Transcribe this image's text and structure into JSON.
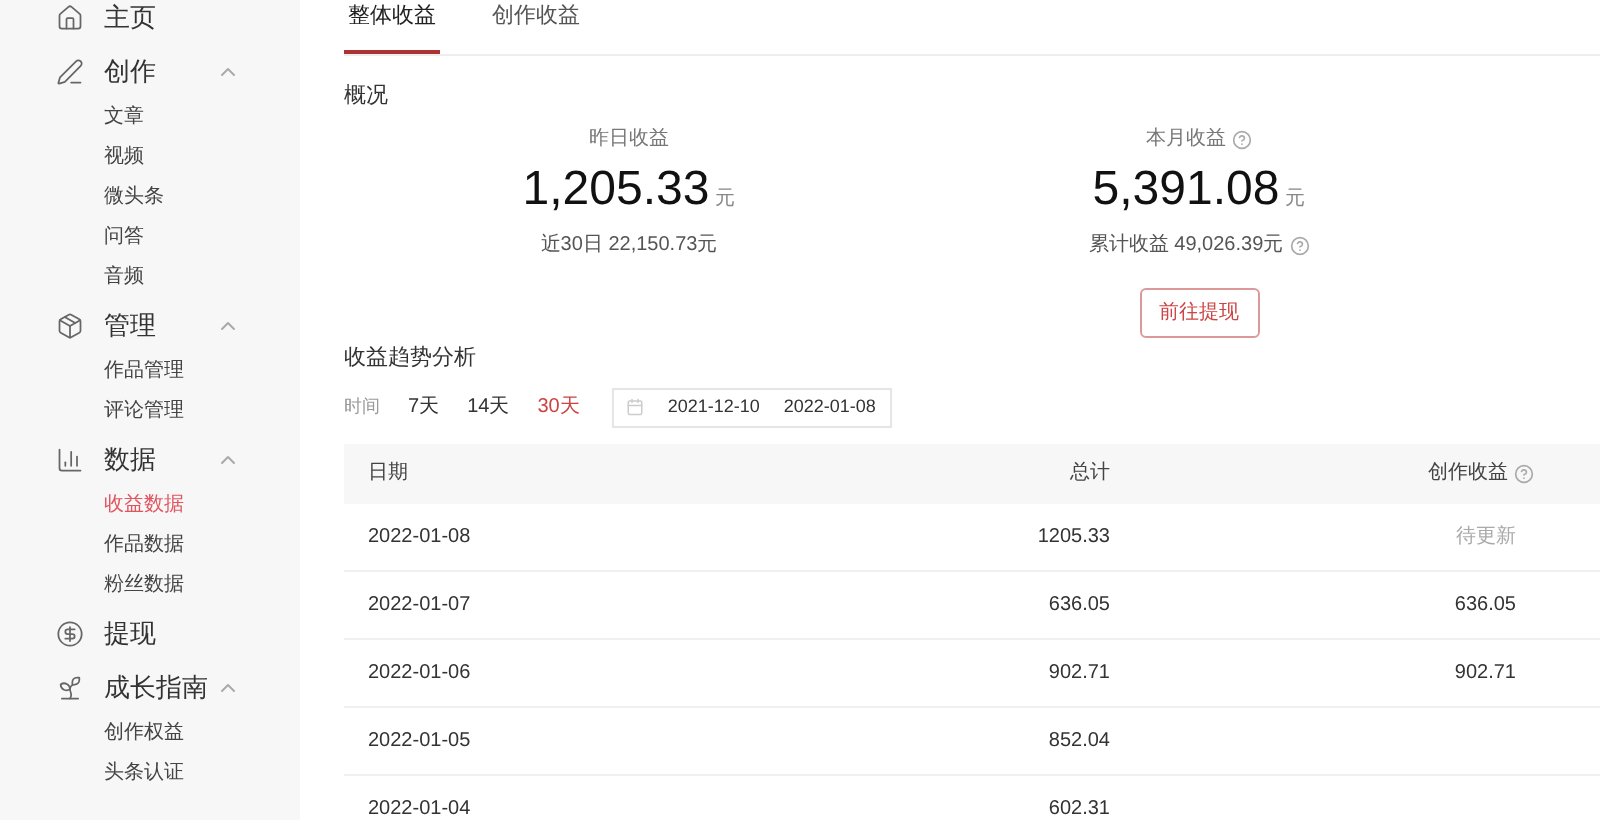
{
  "sidebar": {
    "sections": [
      {
        "title": "主页"
      },
      {
        "title": "创作",
        "expanded": true,
        "items": [
          {
            "label": "文章",
            "selected": false
          },
          {
            "label": "视频",
            "selected": false
          },
          {
            "label": "微头条",
            "selected": false
          },
          {
            "label": "问答",
            "selected": false
          },
          {
            "label": "音频",
            "selected": false
          }
        ]
      },
      {
        "title": "管理",
        "expanded": true,
        "items": [
          {
            "label": "作品管理",
            "selected": false
          },
          {
            "label": "评论管理",
            "selected": false
          }
        ]
      },
      {
        "title": "数据",
        "expanded": true,
        "items": [
          {
            "label": "收益数据",
            "selected": true
          },
          {
            "label": "作品数据",
            "selected": false
          },
          {
            "label": "粉丝数据",
            "selected": false
          }
        ]
      },
      {
        "title": "提现"
      },
      {
        "title": "成长指南",
        "expanded": true,
        "items": [
          {
            "label": "创作权益",
            "selected": false
          },
          {
            "label": "头条认证",
            "selected": false
          }
        ]
      }
    ]
  },
  "tabs": [
    {
      "label": "整体收益",
      "selected": true
    },
    {
      "label": "创作收益",
      "selected": false
    }
  ],
  "overview": {
    "title": "概况",
    "stats": [
      {
        "label": "昨日收益",
        "value": "1,205.33",
        "unit": "元",
        "sub": "近30日 22,150.73元",
        "help": false,
        "sub_help": false
      },
      {
        "label": "本月收益",
        "value": "5,391.08",
        "unit": "元",
        "sub": "累计收益 49,026.39元",
        "help": true,
        "sub_help": true,
        "button": "前往提现"
      }
    ]
  },
  "trend": {
    "title": "收益趋势分析",
    "range_label": "时间",
    "ranges": [
      {
        "label": "7天",
        "selected": false
      },
      {
        "label": "14天",
        "selected": false
      },
      {
        "label": "30天",
        "selected": true
      }
    ],
    "start": "2021-12-10",
    "end": "2022-01-08"
  },
  "table": {
    "columns": [
      "日期",
      "总计",
      "创作收益"
    ],
    "rows": [
      {
        "date": "2022-01-08",
        "total": "1205.33",
        "creation": "待更新",
        "pending": true
      },
      {
        "date": "2022-01-07",
        "total": "636.05",
        "creation": "636.05",
        "pending": false
      },
      {
        "date": "2022-01-06",
        "total": "902.71",
        "creation": "902.71",
        "pending": false
      },
      {
        "date": "2022-01-05",
        "total": "852.04"
      },
      {
        "date": "2022-01-04",
        "total": "602.31"
      }
    ]
  }
}
